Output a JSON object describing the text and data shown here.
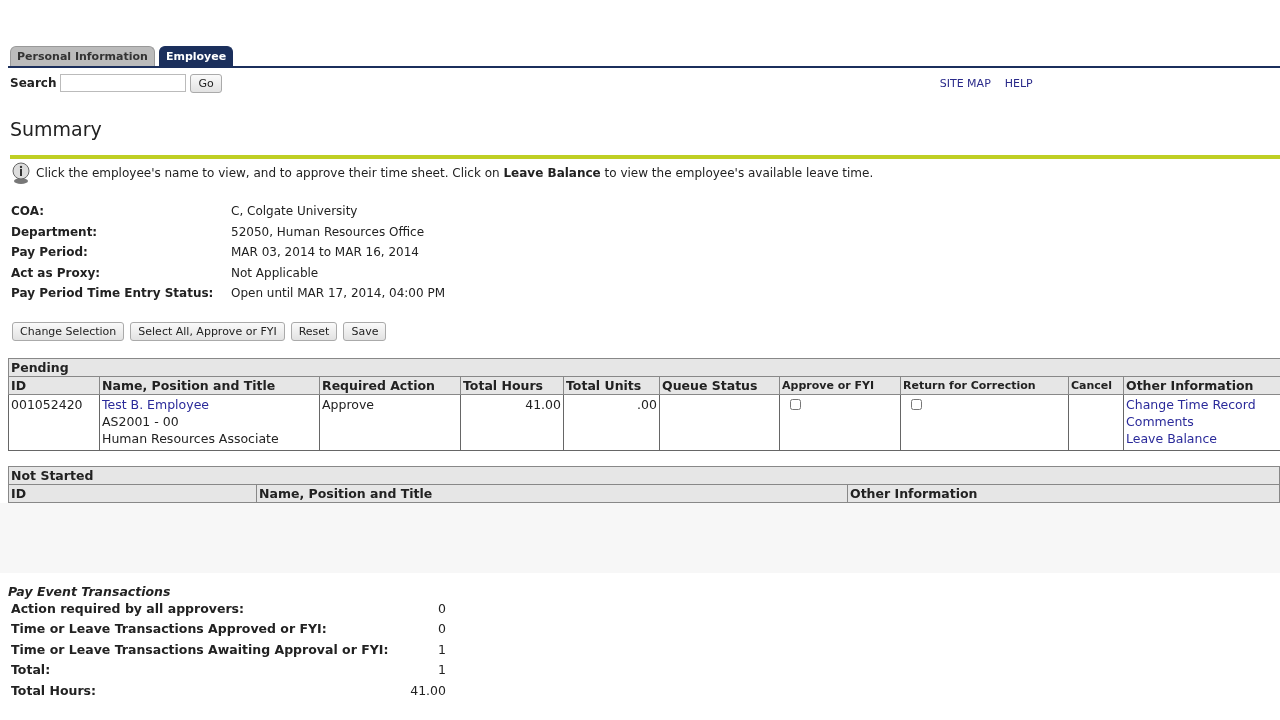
{
  "tabs": [
    {
      "label": "Personal Information",
      "selected": false
    },
    {
      "label": "Employee",
      "selected": true
    }
  ],
  "search": {
    "label": "Search",
    "button": "Go"
  },
  "top_links": [
    "SITE MAP",
    "HELP"
  ],
  "title": "Summary",
  "info": "Click the employee's name to view, and to approve their time sheet. Click on **Leave Balance** to view the employee's available leave time.",
  "fields": [
    {
      "label": "COA:",
      "value": "C, Colgate University"
    },
    {
      "label": "Department:",
      "value": "52050, Human Resources Office"
    },
    {
      "label": "Pay Period:",
      "value": "MAR 03, 2014 to MAR 16, 2014"
    },
    {
      "label": "Act as Proxy:",
      "value": "Not Applicable"
    },
    {
      "label": "Pay Period Time Entry Status:",
      "value": "Open until MAR 17, 2014, 04:00 PM"
    }
  ],
  "buttons": [
    "Change Selection",
    "Select All, Approve or FYI",
    "Reset",
    "Save"
  ],
  "pending": {
    "title": "Pending",
    "columns": [
      "ID",
      "Name, Position and Title",
      "Required Action",
      "Total Hours",
      "Total Units",
      "Queue Status",
      "Approve or FYI",
      "Return for Correction",
      "Cancel",
      "Other Information"
    ],
    "rows": [
      {
        "id": "001052420",
        "name": "Test B. Employee",
        "position": "AS2001 - 00",
        "job_title": "Human Resources Associate",
        "required_action": "Approve",
        "total_hours": "41.00",
        "total_units": ".00",
        "approve_checked": false,
        "return_checked": false,
        "links": [
          "Change Time Record",
          "Comments",
          "Leave Balance"
        ]
      }
    ]
  },
  "not_started": {
    "title": "Not Started",
    "columns": [
      "ID",
      "Name, Position and Title",
      "Other Information"
    ]
  },
  "pay_event": {
    "title": "Pay Event Transactions",
    "rows": [
      {
        "label": "Action required by all approvers:",
        "value": "0"
      },
      {
        "label": "Time or Leave Transactions Approved or FYI:",
        "value": "0"
      },
      {
        "label": "Time or Leave Transactions Awaiting Approval or FYI:",
        "value": "1"
      },
      {
        "label": "Total:",
        "value": "1"
      },
      {
        "label": "Total Hours:",
        "value": "41.00"
      }
    ]
  }
}
